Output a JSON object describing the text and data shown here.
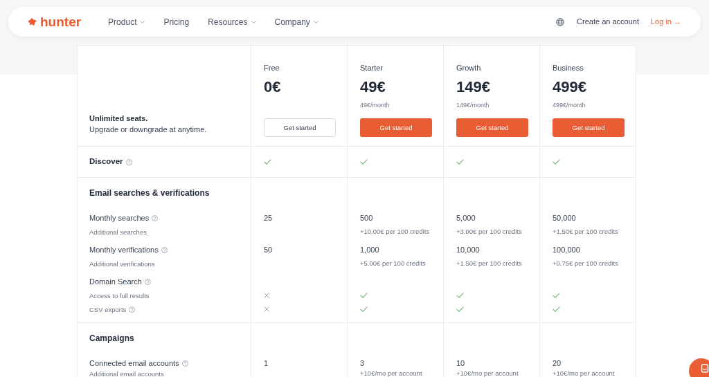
{
  "nav": {
    "logo": "hunter",
    "links": [
      {
        "label": "Product",
        "dropdown": true
      },
      {
        "label": "Pricing",
        "dropdown": false
      },
      {
        "label": "Resources",
        "dropdown": true
      },
      {
        "label": "Company",
        "dropdown": true
      }
    ],
    "actions": [
      {
        "label": "Create an account",
        "kind": "plain"
      },
      {
        "label": "Log in →",
        "kind": "accent"
      }
    ]
  },
  "intro": {
    "title": "Unlimited seats.",
    "text": "Upgrade or downgrade at anytime."
  },
  "plans": [
    {
      "name": "Free",
      "price": "0€",
      "button": {
        "label": "Get started",
        "kind": "outline"
      }
    },
    {
      "name": "Starter",
      "price": "49€",
      "billing": "49€/month",
      "button": {
        "label": "Get started",
        "kind": "filled"
      }
    },
    {
      "name": "Growth",
      "price": "149€",
      "billing": "149€/month",
      "button": {
        "label": "Get started",
        "kind": "filled"
      }
    },
    {
      "name": "Business",
      "price": "499€",
      "billing": "499€/month",
      "button": {
        "label": "Get started",
        "kind": "filled"
      }
    }
  ],
  "sections": [
    {
      "kind": "single",
      "label": "Discover",
      "help": true,
      "cells": [
        {
          "included": true
        },
        {
          "included": true
        },
        {
          "included": true
        },
        {
          "included": true
        }
      ]
    },
    {
      "kind": "group",
      "title": "Email searches & verifications",
      "rows": [
        {
          "kind": "main",
          "label": "Monthly searches",
          "help": true,
          "cells": [
            {
              "text": "25"
            },
            {
              "text": "500"
            },
            {
              "text": "5,000"
            },
            {
              "text": "50,000"
            }
          ]
        },
        {
          "kind": "sub",
          "label": "Additional searches",
          "help": false,
          "cells": [
            null,
            {
              "text": "+10.00€ per 100 credits"
            },
            {
              "text": "+3.00€ per 100 credits"
            },
            {
              "text": "+1.50€ per 100 credits"
            }
          ]
        },
        {
          "kind": "main",
          "label": "Monthly verifications",
          "help": true,
          "cells": [
            {
              "text": "50"
            },
            {
              "text": "1,000"
            },
            {
              "text": "10,000"
            },
            {
              "text": "100,000"
            }
          ]
        },
        {
          "kind": "sub",
          "label": "Additional verifications",
          "help": false,
          "cells": [
            null,
            {
              "text": "+5.00€ per 100 credits"
            },
            {
              "text": "+1.50€ per 100 credits"
            },
            {
              "text": "+0.75€ per 100 credits"
            }
          ]
        },
        {
          "kind": "main",
          "label": "Domain Search",
          "help": true
        },
        {
          "kind": "sub",
          "label": "Access to full results",
          "help": false,
          "cells": [
            {
              "included": false
            },
            {
              "included": true
            },
            {
              "included": true
            },
            {
              "included": true
            }
          ]
        },
        {
          "kind": "sub",
          "label": "CSV exports",
          "help": true,
          "cells": [
            {
              "included": false
            },
            {
              "included": true
            },
            {
              "included": true
            },
            {
              "included": true
            }
          ]
        }
      ]
    },
    {
      "kind": "group",
      "title": "Campaigns",
      "rows": [
        {
          "kind": "main",
          "label": "Connected email accounts",
          "help": true,
          "cells": [
            {
              "text": "1"
            },
            {
              "text": "3"
            },
            {
              "text": "10"
            },
            {
              "text": "20"
            }
          ]
        },
        {
          "kind": "sub",
          "label": "Additional email accounts",
          "help": false,
          "cells": [
            null,
            {
              "text": "+10€/mo per account"
            },
            {
              "text": "+10€/mo per account"
            },
            {
              "text": "+10€/mo per account"
            }
          ]
        }
      ]
    }
  ]
}
